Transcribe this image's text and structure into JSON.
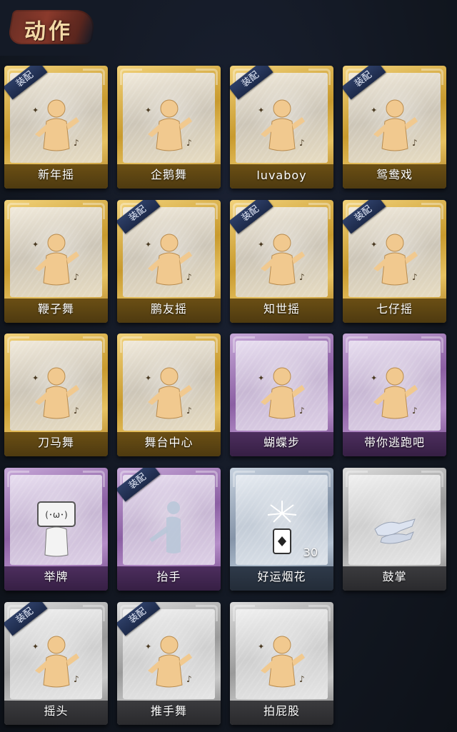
{
  "header": {
    "title": "动作"
  },
  "badge_text": "装配",
  "cards": [
    {
      "label": "新年摇",
      "rarity": "gold",
      "equipped": true,
      "icon": "dance-figure-icon"
    },
    {
      "label": "企鹅舞",
      "rarity": "gold",
      "equipped": false,
      "icon": "dance-figure-icon"
    },
    {
      "label": "luvaboy",
      "rarity": "gold",
      "equipped": true,
      "icon": "dance-figure-icon"
    },
    {
      "label": "鸳鸯戏",
      "rarity": "gold",
      "equipped": true,
      "icon": "dance-figure-icon"
    },
    {
      "label": "鞭子舞",
      "rarity": "gold",
      "equipped": false,
      "icon": "dance-figure-icon"
    },
    {
      "label": "鹏友摇",
      "rarity": "gold",
      "equipped": true,
      "icon": "dance-figure-icon"
    },
    {
      "label": "知世摇",
      "rarity": "gold",
      "equipped": true,
      "icon": "dance-figure-icon"
    },
    {
      "label": "七仔摇",
      "rarity": "gold",
      "equipped": true,
      "icon": "dance-figure-icon"
    },
    {
      "label": "刀马舞",
      "rarity": "gold",
      "equipped": false,
      "icon": "dance-figure-icon"
    },
    {
      "label": "舞台中心",
      "rarity": "gold",
      "equipped": false,
      "icon": "dance-figure-icon"
    },
    {
      "label": "蝴蝶步",
      "rarity": "purple",
      "equipped": false,
      "icon": "dance-figure-icon"
    },
    {
      "label": "带你逃跑吧",
      "rarity": "purple",
      "equipped": false,
      "icon": "dance-figure-icon"
    },
    {
      "label": "举牌",
      "rarity": "purple",
      "equipped": false,
      "icon": "sign-holding-figure-icon"
    },
    {
      "label": "抬手",
      "rarity": "purple",
      "equipped": true,
      "icon": "raise-hand-figure-icon"
    },
    {
      "label": "好运烟花",
      "rarity": "blue",
      "equipped": false,
      "icon": "firework-can-icon",
      "count": "30"
    },
    {
      "label": "鼓掌",
      "rarity": "silver",
      "equipped": false,
      "icon": "clapping-hands-icon"
    },
    {
      "label": "摇头",
      "rarity": "silver",
      "equipped": true,
      "icon": "dance-figure-icon"
    },
    {
      "label": "推手舞",
      "rarity": "silver",
      "equipped": true,
      "icon": "dance-figure-icon"
    },
    {
      "label": "拍屁股",
      "rarity": "silver",
      "equipped": false,
      "icon": "dance-figure-icon"
    }
  ],
  "colors": {
    "gold": "#c89a2e",
    "purple": "#8b5fa3",
    "blue": "#8594a8",
    "silver": "#9a9a9a",
    "badge": "#1d2a4a",
    "background": "#121826"
  }
}
